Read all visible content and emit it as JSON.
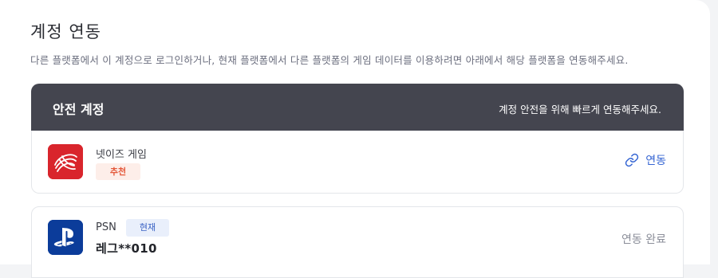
{
  "page": {
    "title": "계정 연동",
    "description": "다른 플랫폼에서 이 계정으로 로그인하거나, 현재 플랫폼에서 다른 플랫폼의 게임 데이터를 이용하려면 아래에서 해당 플랫폼을 연동해주세요."
  },
  "safe_account": {
    "title": "안전 계정",
    "hint": "계정 안전을 위해 빠르게 연동해주세요."
  },
  "platforms": [
    {
      "name": "넷이즈 게임",
      "badge": "추천",
      "action_label": "연동",
      "icon": "netease-logo-icon",
      "logo_color": "#d9252c"
    },
    {
      "name": "PSN",
      "badge": "현재",
      "account": "레그**010",
      "status": "연동 완료",
      "icon": "playstation-logo-icon",
      "logo_color": "#0b3c9a"
    }
  ],
  "colors": {
    "header_bg": "#44454f",
    "link_blue": "#3565d3",
    "recommend_red": "#e4593b"
  }
}
